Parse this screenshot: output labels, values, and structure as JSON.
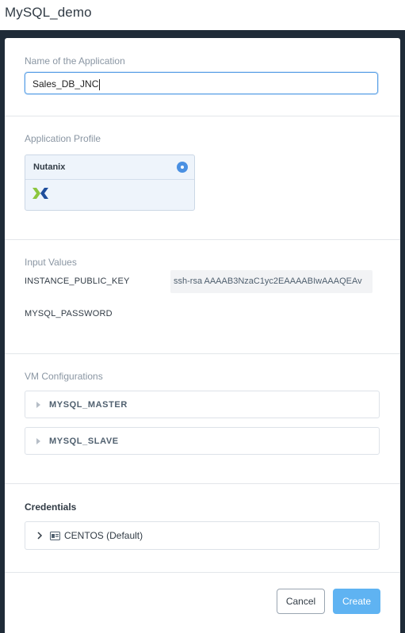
{
  "window": {
    "title": "MySQL_demo"
  },
  "app_name": {
    "label": "Name of the Application",
    "value": "Sales_DB_JNC"
  },
  "profile": {
    "label": "Application Profile",
    "selected": "Nutanix",
    "logo_icon": "nutanix-logo-icon"
  },
  "inputs": {
    "label": "Input Values",
    "fields": [
      {
        "name": "INSTANCE_PUBLIC_KEY",
        "value": "ssh-rsa AAAAB3NzaC1yc2EAAAABIwAAAQEAv"
      },
      {
        "name": "MYSQL_PASSWORD",
        "value": ""
      }
    ]
  },
  "vm": {
    "label": "VM Configurations",
    "items": [
      "MYSQL_MASTER",
      "MYSQL_SLAVE"
    ]
  },
  "credentials": {
    "label": "Credentials",
    "item": "CENTOS (Default)"
  },
  "actions": {
    "cancel": "Cancel",
    "create": "Create"
  },
  "colors": {
    "overlay": "#1f2b38",
    "accent": "#4a90e2",
    "create_button": "#5fb3f2",
    "nutanix_green": "#8cc63f",
    "nutanix_blue": "#1f4e9c"
  }
}
